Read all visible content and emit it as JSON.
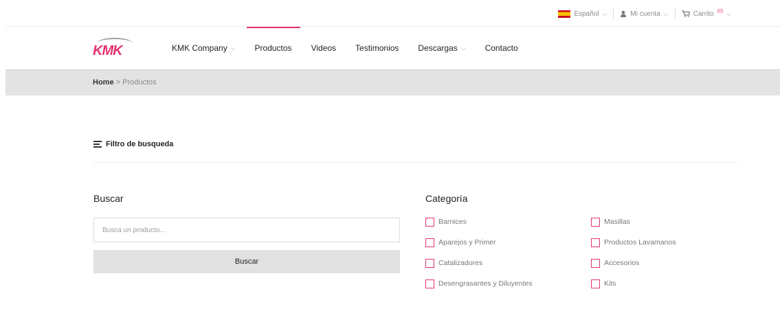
{
  "topbar": {
    "language": "Español",
    "account": "Mi cuenta",
    "cart": "Carrito",
    "cart_count": "(0)"
  },
  "logo": {
    "text": "KMK"
  },
  "nav": {
    "items": [
      {
        "label": "KMK Company",
        "has_dropdown": true
      },
      {
        "label": "Productos",
        "active": true
      },
      {
        "label": "Videos"
      },
      {
        "label": "Testimonios"
      },
      {
        "label": "Descargas",
        "has_dropdown": true
      },
      {
        "label": "Contacto"
      }
    ]
  },
  "breadcrumb": {
    "home": "Home",
    "separator": ">",
    "current": "Productos"
  },
  "filter": {
    "title": "Filtro de busqueda"
  },
  "search": {
    "heading": "Buscar",
    "placeholder": "Busca un producto...",
    "button": "Buscar"
  },
  "category": {
    "heading": "Categoría",
    "left": [
      "Barnices",
      "Aparejos y Primer",
      "Catalizadores",
      "Desengrasantes y Diluyentes"
    ],
    "right": [
      "Masillas",
      "Productos Lavamanos",
      "Accesorios",
      "Kits"
    ]
  },
  "colors": {
    "accent": "#e6346c",
    "crumb_bg": "#e3e3e3"
  }
}
